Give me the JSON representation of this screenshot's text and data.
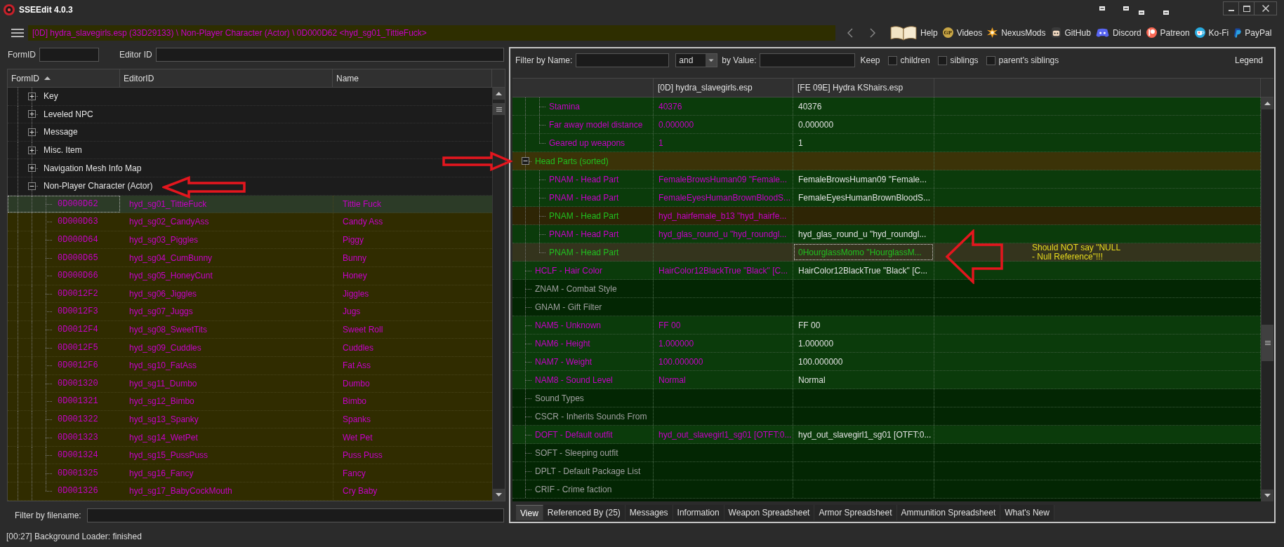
{
  "window": {
    "title": "SSEEdit 4.0.3"
  },
  "toolbar": {
    "breadcrumb": "[0D] hydra_slavegirls.esp (33D29133) \\ Non-Player Character (Actor) \\ 0D000D62 <hyd_sg01_TittieFuck>",
    "links": [
      {
        "kind": "book",
        "label": "Help"
      },
      {
        "kind": "badge",
        "badge": "GP",
        "label": "Videos"
      },
      {
        "kind": "pinwheel",
        "label": "NexusMods"
      },
      {
        "kind": "face",
        "label": "GitHub"
      },
      {
        "kind": "controller",
        "label": "Discord"
      },
      {
        "kind": "ring",
        "label": "Patreon"
      },
      {
        "kind": "cup",
        "label": "Ko-Fi"
      },
      {
        "kind": "slant",
        "label": "PayPal"
      }
    ]
  },
  "left_panel": {
    "formid_label": "FormID",
    "editorid_label": "Editor ID",
    "columns": [
      {
        "label": "FormID",
        "sorted": true
      },
      {
        "label": "EditorID",
        "sorted": false
      },
      {
        "label": "Name",
        "sorted": false
      }
    ],
    "tree": [
      {
        "kind": "group",
        "label": "Key",
        "expanded": false,
        "selected": false
      },
      {
        "kind": "group",
        "label": "Leveled NPC",
        "expanded": false,
        "selected": false
      },
      {
        "kind": "group",
        "label": "Message",
        "expanded": false,
        "selected": false
      },
      {
        "kind": "group",
        "label": "Misc. Item",
        "expanded": false,
        "selected": false
      },
      {
        "kind": "group",
        "label": "Navigation Mesh Info Map",
        "expanded": false,
        "selected": false
      },
      {
        "kind": "group",
        "label": "Non-Player Character (Actor)",
        "expanded": true,
        "selected": false,
        "arrow_left": true,
        "children": [
          {
            "kind": "record",
            "form_id": "0D000D62",
            "editor_id": "hyd_sg01_TittieFuck",
            "name": "Tittie Fuck",
            "selected": true
          },
          {
            "kind": "record",
            "form_id": "0D000D63",
            "editor_id": "hyd_sg02_CandyAss",
            "name": "Candy Ass",
            "selected": false
          },
          {
            "kind": "record",
            "form_id": "0D000D64",
            "editor_id": "hyd_sg03_Piggles",
            "name": "Piggy",
            "selected": false
          },
          {
            "kind": "record",
            "form_id": "0D000D65",
            "editor_id": "hyd_sg04_CumBunny",
            "name": "Bunny",
            "selected": false
          },
          {
            "kind": "record",
            "form_id": "0D000D66",
            "editor_id": "hyd_sg05_HoneyCunt",
            "name": "Honey",
            "selected": false
          },
          {
            "kind": "record",
            "form_id": "0D0012F2",
            "editor_id": "hyd_sg06_Jiggles",
            "name": "Jiggles",
            "selected": false
          },
          {
            "kind": "record",
            "form_id": "0D0012F3",
            "editor_id": "hyd_sg07_Juggs",
            "name": "Jugs",
            "selected": false
          },
          {
            "kind": "record",
            "form_id": "0D0012F4",
            "editor_id": "hyd_sg08_SweetTits",
            "name": "Sweet Roll",
            "selected": false
          },
          {
            "kind": "record",
            "form_id": "0D0012F5",
            "editor_id": "hyd_sg09_Cuddles",
            "name": "Cuddles",
            "selected": false
          },
          {
            "kind": "record",
            "form_id": "0D0012F6",
            "editor_id": "hyd_sg10_FatAss",
            "name": "Fat Ass",
            "selected": false
          },
          {
            "kind": "record",
            "form_id": "0D001320",
            "editor_id": "hyd_sg11_Dumbo",
            "name": "Dumbo",
            "selected": false
          },
          {
            "kind": "record",
            "form_id": "0D001321",
            "editor_id": "hyd_sg12_Bimbo",
            "name": "Bimbo",
            "selected": false
          },
          {
            "kind": "record",
            "form_id": "0D001322",
            "editor_id": "hyd_sg13_Spanky",
            "name": "Spanks",
            "selected": false
          },
          {
            "kind": "record",
            "form_id": "0D001323",
            "editor_id": "hyd_sg14_WetPet",
            "name": "Wet Pet",
            "selected": false
          },
          {
            "kind": "record",
            "form_id": "0D001324",
            "editor_id": "hyd_sg15_PussPuss",
            "name": "Puss Puss",
            "selected": false
          },
          {
            "kind": "record",
            "form_id": "0D001325",
            "editor_id": "hyd_sg16_Fancy",
            "name": "Fancy",
            "selected": false
          },
          {
            "kind": "record",
            "form_id": "0D001326",
            "editor_id": "hyd_sg17_BabyCockMouth",
            "name": "Cry Baby",
            "selected": false
          }
        ]
      }
    ],
    "filter_label": "Filter by filename:"
  },
  "right_panel": {
    "filter": {
      "name_label": "Filter by Name:",
      "operator": "and",
      "value_label": "by Value:",
      "keep_label": "Keep",
      "options": [
        {
          "label": "children",
          "checked": false
        },
        {
          "label": "siblings",
          "checked": false
        },
        {
          "label": "parent's siblings",
          "checked": false
        }
      ],
      "legend": "Legend"
    },
    "grid": {
      "columns": [
        "[0D] hydra_slavegirls.esp",
        "[FE 09E] Hydra KShairs.esp"
      ],
      "rows": [
        {
          "children": [
            {
              "label": {
                "text": "Stamina",
                "color": "#c800c8"
              },
              "color": "#0b3b0b",
              "value_1": {
                "text": "40376",
                "color": "#c800c8",
                "selected": false
              },
              "value_2": {
                "text": "40376",
                "color": "#e0e0e0",
                "selected": false
              }
            },
            {
              "label": {
                "text": "Far away model distance",
                "color": "#c800c8"
              },
              "color": "#0b3b0b",
              "value_1": {
                "text": "0.000000",
                "color": "#c800c8",
                "selected": false
              },
              "value_2": {
                "text": "0.000000",
                "color": "#e0e0e0",
                "selected": false
              }
            },
            {
              "label": {
                "text": "Geared up weapons",
                "color": "#c800c8"
              },
              "color": "#0b3b0b",
              "value_1": {
                "text": "1",
                "color": "#c800c8",
                "selected": false
              },
              "value_2": {
                "text": "1",
                "color": "#e0e0e0",
                "selected": false
              }
            }
          ]
        },
        {
          "label": {
            "text": "Head Parts (sorted)",
            "color": "#20c020"
          },
          "color": "#3b3308",
          "expanded": true,
          "arrow_right": true,
          "children": [
            {
              "label": {
                "text": "PNAM - Head Part",
                "color": "#c800c8"
              },
              "color": "#0b3b0b",
              "value_1": {
                "text": "FemaleBrowsHuman09 \"Female...",
                "color": "#c800c8",
                "selected": false
              },
              "value_2": {
                "text": "FemaleBrowsHuman09 \"Female...",
                "color": "#e0e0e0",
                "selected": false
              }
            },
            {
              "label": {
                "text": "PNAM - Head Part",
                "color": "#c800c8"
              },
              "color": "#0b3b0b",
              "value_1": {
                "text": "FemaleEyesHumanBrownBloodS...",
                "color": "#c800c8",
                "selected": false
              },
              "value_2": {
                "text": "FemaleEyesHumanBrownBloodS...",
                "color": "#e0e0e0",
                "selected": false
              }
            },
            {
              "label": {
                "text": "PNAM - Head Part",
                "color": "#20c020"
              },
              "color": "#2e2505",
              "value_1": {
                "text": "hyd_hairfemale_b13 \"hyd_hairfe...",
                "color": "#c800c8",
                "selected": false
              }
            },
            {
              "label": {
                "text": "PNAM - Head Part",
                "color": "#c800c8"
              },
              "color": "#0b3b0b",
              "value_1": {
                "text": "hyd_glas_round_u \"hyd_roundgl...",
                "color": "#c800c8",
                "selected": false
              },
              "value_2": {
                "text": "hyd_glas_round_u \"hyd_roundgl...",
                "color": "#e0e0e0",
                "selected": false
              }
            },
            {
              "label": {
                "text": "PNAM - Head Part",
                "color": "#20c020"
              },
              "color": "#34341d",
              "arrow_left": true,
              "note": [
                "Should NOT say \"NULL",
                "- Null Reference\"!!!"
              ],
              "value_2": {
                "text": "0HourglassMomo \"HourglassM...",
                "color": "#20c020",
                "selected": true
              }
            }
          ]
        },
        {
          "label": {
            "text": "HCLF - Hair Color",
            "color": "#c800c8"
          },
          "color": "#0b3b0b",
          "value_1": {
            "text": "HairColor12BlackTrue \"Black\" [C...",
            "color": "#c800c8",
            "selected": false
          },
          "value_2": {
            "text": "HairColor12BlackTrue \"Black\" [C...",
            "color": "#e0e0e0",
            "selected": false
          }
        },
        {
          "label": {
            "text": "ZNAM - Combat Style",
            "color": "#a0a0a0"
          },
          "color": "#032603"
        },
        {
          "label": {
            "text": "GNAM - Gift Filter",
            "color": "#a0a0a0"
          },
          "color": "#032603"
        },
        {
          "label": {
            "text": "NAM5 - Unknown",
            "color": "#c800c8"
          },
          "color": "#0b3b0b",
          "value_1": {
            "text": "FF 00",
            "color": "#c800c8",
            "selected": false
          },
          "value_2": {
            "text": "FF 00",
            "color": "#e0e0e0",
            "selected": false
          }
        },
        {
          "label": {
            "text": "NAM6 - Height",
            "color": "#c800c8"
          },
          "color": "#0b3b0b",
          "value_1": {
            "text": "1.000000",
            "color": "#c800c8",
            "selected": false
          },
          "value_2": {
            "text": "1.000000",
            "color": "#e0e0e0",
            "selected": false
          }
        },
        {
          "label": {
            "text": "NAM7 - Weight",
            "color": "#c800c8"
          },
          "color": "#0b3b0b",
          "value_1": {
            "text": "100.000000",
            "color": "#c800c8",
            "selected": false
          },
          "value_2": {
            "text": "100.000000",
            "color": "#e0e0e0",
            "selected": false
          }
        },
        {
          "label": {
            "text": "NAM8 - Sound Level",
            "color": "#c800c8"
          },
          "color": "#0b3b0b",
          "value_1": {
            "text": "Normal",
            "color": "#c800c8",
            "selected": false
          },
          "value_2": {
            "text": "Normal",
            "color": "#e0e0e0",
            "selected": false
          }
        },
        {
          "label": {
            "text": "Sound Types",
            "color": "#a0a0a0"
          },
          "color": "#032603"
        },
        {
          "label": {
            "text": "CSCR - Inherits Sounds From",
            "color": "#a0a0a0"
          },
          "color": "#032603"
        },
        {
          "label": {
            "text": "DOFT - Default outfit",
            "color": "#c800c8"
          },
          "color": "#0b3b0b",
          "value_1": {
            "text": "hyd_out_slavegirl1_sg01 [OTFT:0...",
            "color": "#c800c8",
            "selected": false
          },
          "value_2": {
            "text": "hyd_out_slavegirl1_sg01 [OTFT:0...",
            "color": "#e0e0e0",
            "selected": false
          }
        },
        {
          "label": {
            "text": "SOFT - Sleeping outfit",
            "color": "#a0a0a0"
          },
          "color": "#032603"
        },
        {
          "label": {
            "text": "DPLT - Default Package List",
            "color": "#a0a0a0"
          },
          "color": "#032603"
        },
        {
          "label": {
            "text": "CRIF - Crime faction",
            "color": "#a0a0a0"
          },
          "color": "#032603"
        }
      ]
    },
    "tabs": [
      {
        "label": "View",
        "selected": true
      },
      {
        "label": "Referenced By (25)",
        "selected": false
      },
      {
        "label": "Messages",
        "selected": false
      },
      {
        "label": "Information",
        "selected": false
      },
      {
        "label": "Weapon Spreadsheet",
        "selected": false
      },
      {
        "label": "Armor Spreadsheet",
        "selected": false
      },
      {
        "label": "Ammunition Spreadsheet",
        "selected": false
      },
      {
        "label": "What's New",
        "selected": false
      }
    ]
  },
  "status_bar": {
    "text": "[00:27] Background Loader: finished"
  }
}
